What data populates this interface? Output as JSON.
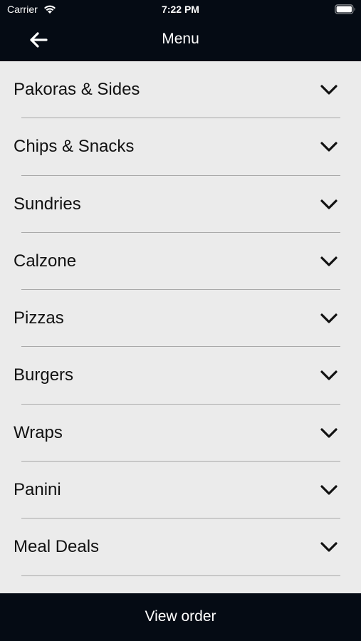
{
  "status_bar": {
    "carrier": "Carrier",
    "time": "7:22 PM"
  },
  "header": {
    "title": "Menu",
    "back_icon": "arrow-left-icon"
  },
  "menu": {
    "items": [
      {
        "label": "Pakoras & Sides"
      },
      {
        "label": "Chips & Snacks"
      },
      {
        "label": "Sundries"
      },
      {
        "label": "Calzone"
      },
      {
        "label": "Pizzas"
      },
      {
        "label": "Burgers"
      },
      {
        "label": "Wraps"
      },
      {
        "label": "Panini"
      },
      {
        "label": "Meal Deals"
      }
    ],
    "expand_icon": "chevron-down-icon"
  },
  "footer": {
    "view_order_label": "View order"
  },
  "colors": {
    "bar_background": "#050b14",
    "list_background": "#ebebeb",
    "text": "#121212",
    "divider": "#a9a9a9"
  }
}
